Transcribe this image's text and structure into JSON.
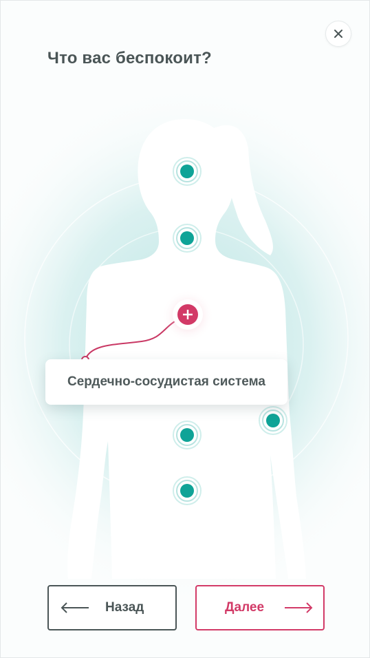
{
  "question": {
    "title": "Что вас беспокоит?"
  },
  "close": {
    "icon": "close-icon"
  },
  "figure": {
    "hotspots": [
      {
        "name": "head",
        "state": "inactive"
      },
      {
        "name": "neck",
        "state": "inactive"
      },
      {
        "name": "chest",
        "state": "active"
      },
      {
        "name": "right-arm",
        "state": "inactive"
      },
      {
        "name": "abdomen",
        "state": "inactive"
      },
      {
        "name": "pelvis",
        "state": "inactive"
      }
    ],
    "colors": {
      "accent": "#0fa397",
      "active": "#d23a67",
      "glow": "#bfe6e6"
    }
  },
  "tooltip": {
    "label": "Сердечно-сосудистая система"
  },
  "buttons": {
    "back": {
      "label": "Назад",
      "icon": "arrow-left-icon"
    },
    "next": {
      "label": "Далее",
      "icon": "arrow-right-icon"
    }
  }
}
